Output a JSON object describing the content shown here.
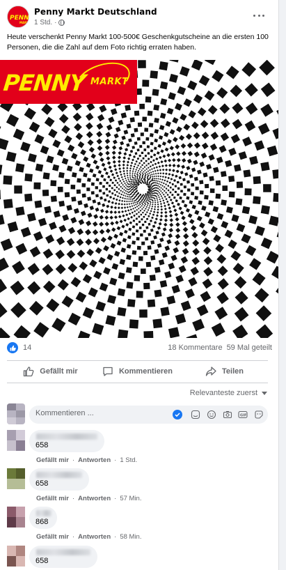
{
  "post": {
    "page_name": "Penny Markt Deutschland",
    "time": "1 Std.",
    "time_separator": "·",
    "text": "Heute verschenkt Penny Markt 100-500€ Geschenkgutscheine an die ersten 100 Personen, die die Zahl auf dem Foto richtig erraten haben."
  },
  "photo": {
    "logo_penny": "PENNY",
    "logo_markt": "MARKT",
    "brand_red": "#e2001a",
    "brand_yellow": "#ffec00"
  },
  "reactions": {
    "like_count": "14",
    "comments": "18 Kommentare",
    "shares": "59 Mal geteilt"
  },
  "actions": {
    "like": "Gefällt mir",
    "comment": "Kommentieren",
    "share": "Teilen"
  },
  "sort": {
    "label": "Relevanteste zuerst"
  },
  "composer": {
    "placeholder": "Kommentieren ...",
    "icons": [
      "emoji-icon",
      "sticker-icon",
      "camera-icon",
      "gif-icon",
      "sticker-face-icon"
    ]
  },
  "comments": [
    {
      "text": "658",
      "like": "Gefällt mir",
      "reply": "Antworten",
      "time": "1 Std."
    },
    {
      "text": "658",
      "like": "Gefällt mir",
      "reply": "Antworten",
      "time": "57 Min."
    },
    {
      "text": "868",
      "like": "Gefällt mir",
      "reply": "Antworten",
      "time": "58 Min."
    },
    {
      "text": "658",
      "like": "Gefällt mir",
      "reply": "Antworten",
      "time": ""
    }
  ]
}
